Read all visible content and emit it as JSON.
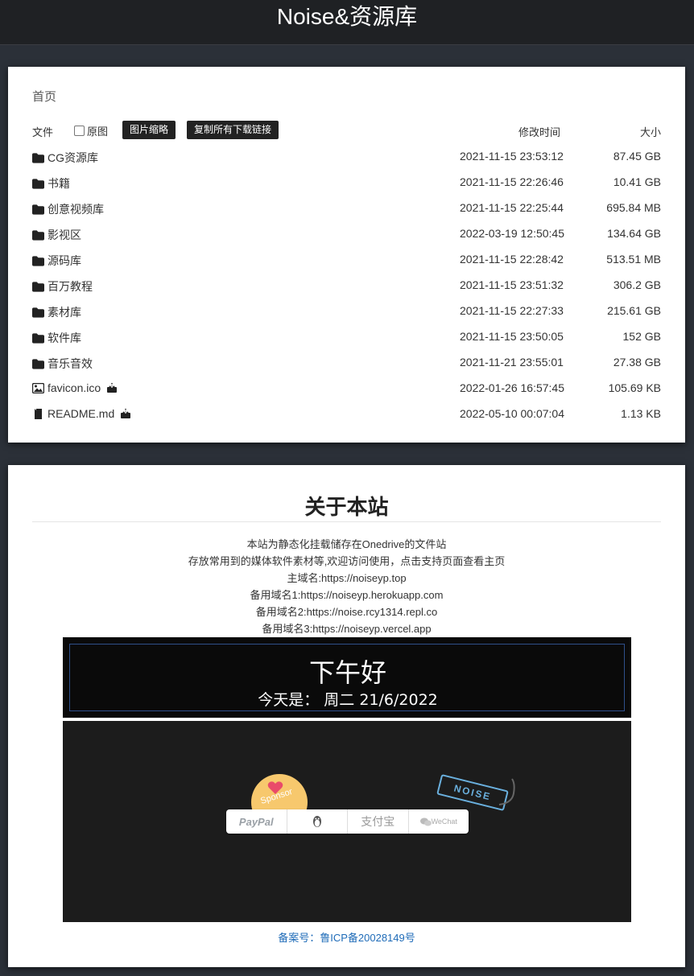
{
  "header": {
    "title": "Noise&资源库"
  },
  "breadcrumb": {
    "home": "首页"
  },
  "list_header": {
    "file_label": "文件",
    "original_label": "原图",
    "thumb_button": "图片缩略",
    "copy_button": "复制所有下载链接",
    "time_label": "修改时间",
    "size_label": "大小"
  },
  "files": [
    {
      "icon": "folder-icon",
      "name": "CG资源库",
      "time": "2021-11-15 23:53:12",
      "size": "87.45 GB"
    },
    {
      "icon": "folder-icon",
      "name": "书籍",
      "time": "2021-11-15 22:26:46",
      "size": "10.41 GB"
    },
    {
      "icon": "folder-icon",
      "name": "创意视频库",
      "time": "2021-11-15 22:25:44",
      "size": "695.84 MB"
    },
    {
      "icon": "folder-icon",
      "name": "影视区",
      "time": "2022-03-19 12:50:45",
      "size": "134.64 GB"
    },
    {
      "icon": "folder-icon",
      "name": "源码库",
      "time": "2021-11-15 22:28:42",
      "size": "513.51 MB"
    },
    {
      "icon": "folder-icon",
      "name": "百万教程",
      "time": "2021-11-15 23:51:32",
      "size": "306.2 GB"
    },
    {
      "icon": "folder-icon",
      "name": "素材库",
      "time": "2021-11-15 22:27:33",
      "size": "215.61 GB"
    },
    {
      "icon": "folder-icon",
      "name": "软件库",
      "time": "2021-11-15 23:50:05",
      "size": "152 GB"
    },
    {
      "icon": "folder-icon",
      "name": "音乐音效",
      "time": "2021-11-21 23:55:01",
      "size": "27.38 GB"
    },
    {
      "icon": "image-icon",
      "name": "favicon.ico",
      "time": "2022-01-26 16:57:45",
      "size": "105.69 KB"
    },
    {
      "icon": "file-icon",
      "name": "README.md",
      "time": "2022-05-10 00:07:04",
      "size": "1.13 KB"
    }
  ],
  "about": {
    "title": "关于本站",
    "lines": [
      "本站为静态化挂载储存在Onedrive的文件站",
      "存放常用到的媒体软件素材等,欢迎访问使用，点击支持页面查看主页",
      "主域名:https://noiseyp.top",
      "备用域名1:https://noiseyp.herokuapp.com",
      "备用域名2:https://noise.rcy1314.repl.co",
      "备用域名3:https://noiseyp.vercel.app"
    ]
  },
  "greeting": {
    "text": "下午好",
    "date_label": "今天是：",
    "date_value": "周二 21/6/2022"
  },
  "sponsor": {
    "badge": "Sponsor",
    "paypal": "PayPal",
    "alipay": "支付宝",
    "wechat": "WeChat",
    "tag": "NOISE"
  },
  "footer": {
    "icp": "备案号：鲁ICP备20028149号"
  },
  "colors": {
    "accent": "#1e6bb8",
    "header_bg": "#1f2124",
    "page_bg": "#2b3038",
    "sponsor_badge": "#f7c86d"
  }
}
